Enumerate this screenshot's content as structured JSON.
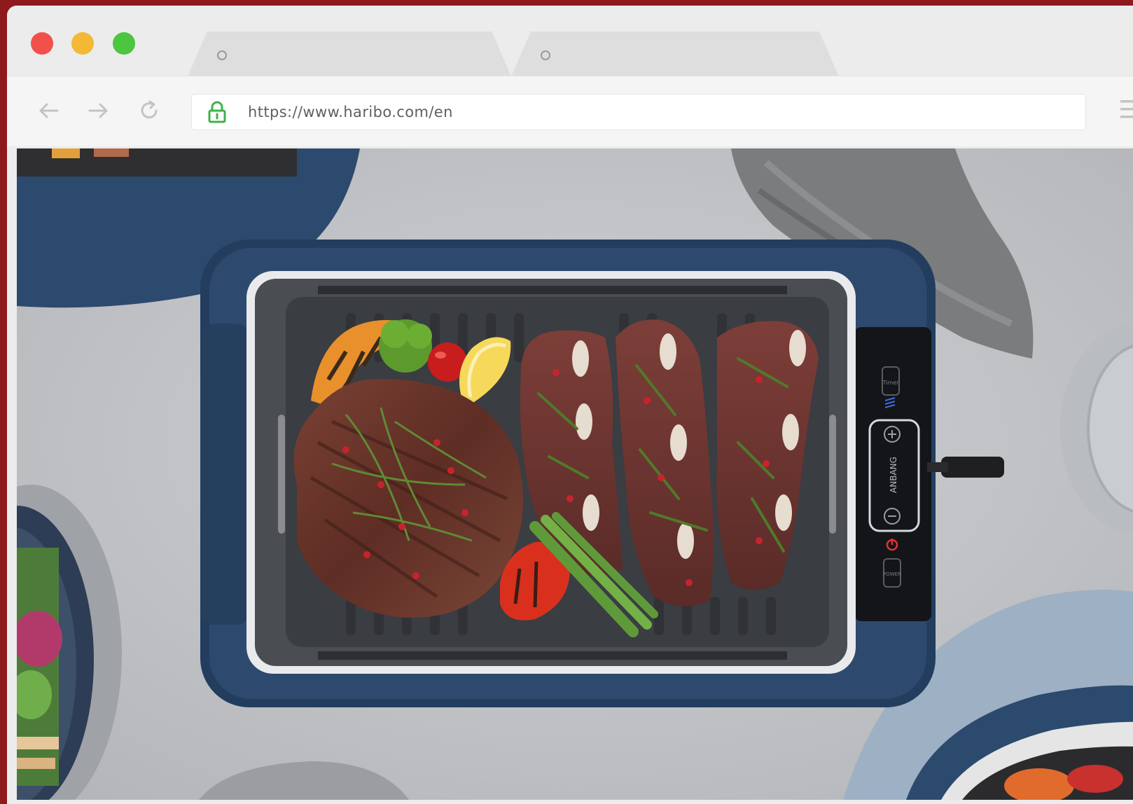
{
  "browser": {
    "window_controls": [
      "close",
      "minimize",
      "maximize"
    ],
    "tabs": [
      {
        "label": "",
        "icon": "tab-favicon-icon"
      },
      {
        "label": "",
        "icon": "tab-favicon-icon"
      }
    ],
    "address_bar": {
      "url": "https://www.haribo.com/en",
      "icon": "lock-icon"
    },
    "nav_icons": [
      "back-arrow-icon",
      "forward-arrow-icon",
      "reload-icon",
      "menu-icon"
    ]
  },
  "page": {
    "image": "overhead view of electric grill with steak, short ribs, vegetables on a grey table",
    "grill_brand": "ANBANG",
    "control_labels": {
      "top": "Timer",
      "bottom": "POWER"
    }
  },
  "colors": {
    "frame": "#8e1a1e",
    "grill_blue": "#2d4a6e",
    "table": "#c5c7cb"
  }
}
